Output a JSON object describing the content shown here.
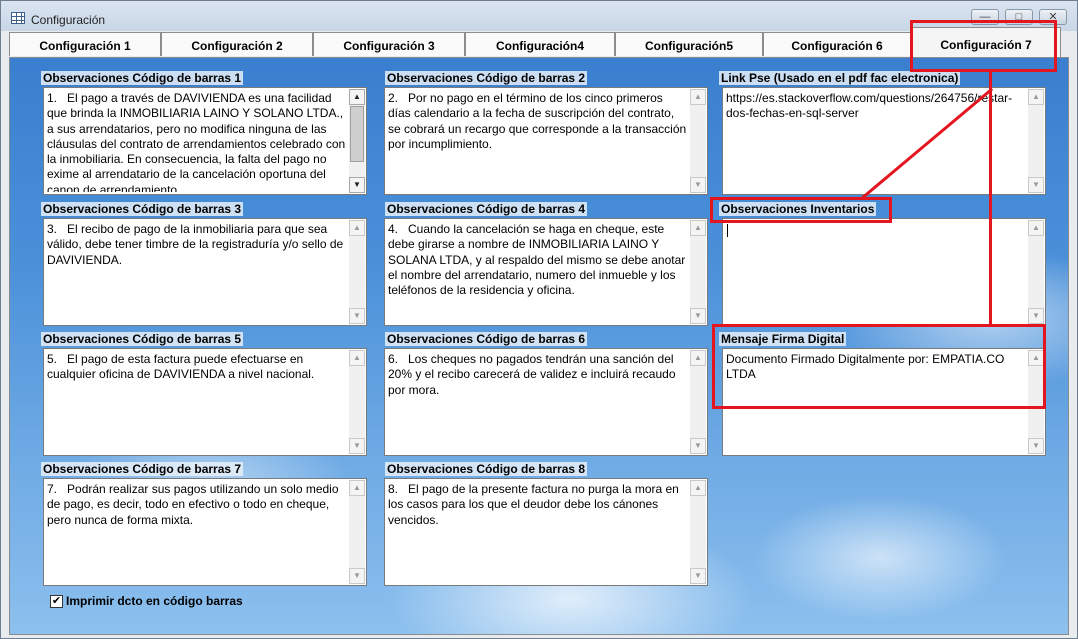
{
  "window": {
    "title": "Configuración",
    "minimize_glyph": "—",
    "maximize_glyph": "□",
    "close_glyph": "✕"
  },
  "tabs": [
    {
      "label": "Configuración 1"
    },
    {
      "label": "Configuración 2"
    },
    {
      "label": "Configuración 3"
    },
    {
      "label": "Configuración4"
    },
    {
      "label": "Configuración5"
    },
    {
      "label": "Configuración 6"
    },
    {
      "label": "Configuración 7",
      "selected": true
    }
  ],
  "fields": {
    "obs1": {
      "label": "Observaciones Código de barras 1",
      "value": "1.   El pago a través de DAVIVIENDA es una facilidad que brinda la INMOBILIARIA LAINO Y SOLANO LTDA., a sus arrendatarios, pero no modifica ninguna de las cláusulas del contrato de arrendamientos celebrado con la inmobiliaria. En consecuencia, la falta del pago no exime al arrendatario de la cancelación oportuna del canon de arrendamiento."
    },
    "obs2": {
      "label": "Observaciones Código de barras 2",
      "value": "2.   Por no pago en el término de los cinco primeros días calendario a la fecha de suscripción del contrato, se cobrará un recargo que corresponde a la transacción por incumplimiento."
    },
    "link_pse": {
      "label": "Link Pse (Usado en el pdf fac electronica)",
      "value": "https://es.stackoverflow.com/questions/264756/restar-dos-fechas-en-sql-server"
    },
    "obs3": {
      "label": "Observaciones Código de barras 3",
      "value": "3.   El recibo de pago de la inmobiliaria para que sea válido, debe tener timbre de la registraduría y/o sello de DAVIVIENDA."
    },
    "obs4": {
      "label": "Observaciones Código de barras 4",
      "value": "4.   Cuando la cancelación se haga en cheque, este debe girarse a nombre de INMOBILIARIA LAINO Y SOLANA LTDA, y al respaldo del mismo se debe anotar el nombre del arrendatario, numero del inmueble y los teléfonos de la residencia y oficina."
    },
    "obs_inventarios": {
      "label": "Observaciones Inventarios",
      "value": ""
    },
    "obs5": {
      "label": "Observaciones Código de barras 5",
      "value": "5.   El pago de esta factura puede efectuarse en cualquier oficina de DAVIVIENDA a nivel nacional."
    },
    "obs6": {
      "label": "Observaciones Código de barras 6",
      "value": "6.   Los cheques no pagados tendrán una sanción del 20% y el recibo carecerá de validez e incluirá recaudo por mora."
    },
    "firma_digital": {
      "label": "Mensaje Firma Digital",
      "value": "Documento Firmado Digitalmente por: EMPATIA.CO LTDA"
    },
    "obs7": {
      "label": "Observaciones Código de barras 7",
      "value": "7.   Podrán realizar sus pagos utilizando un solo medio de pago, es decir, todo en efectivo o todo en cheque, pero nunca de forma mixta."
    },
    "obs8": {
      "label": "Observaciones Código de barras 8",
      "value": "8.   El pago de la presente factura no purga la mora en los casos para los que el deudor debe los cánones vencidos."
    }
  },
  "print_barcode": {
    "label": "Imprimir dcto en código barras",
    "checked": true,
    "check_glyph": "✔"
  },
  "scroll_glyphs": {
    "up": "▲",
    "down": "▼"
  },
  "annotation_color": "#e3151e"
}
